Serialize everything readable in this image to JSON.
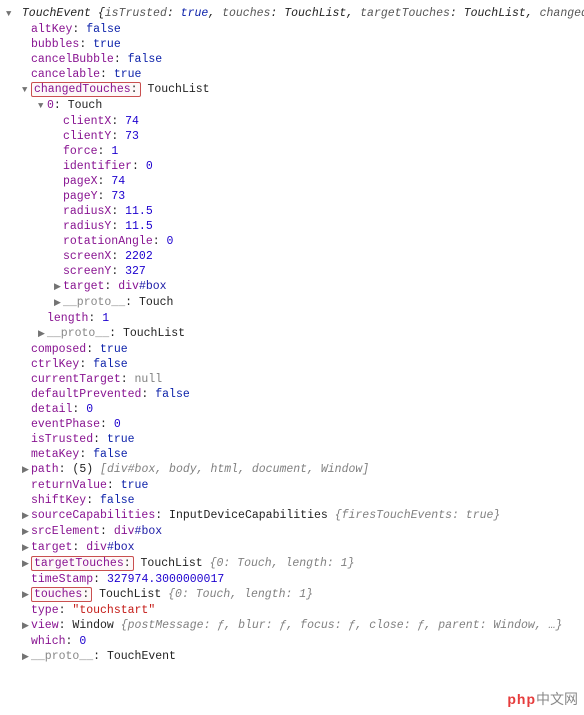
{
  "root": {
    "type": "TouchEvent",
    "preview_keys": [
      "isTrusted",
      "touches",
      "targetTouches",
      "changedTou"
    ],
    "preview": {
      "isTrusted": "true",
      "touches": "TouchList",
      "targetTouches": "TouchList",
      "changedTou": ""
    }
  },
  "props": {
    "altKey": "false",
    "bubbles": "true",
    "cancelBubble": "false",
    "cancelable": "true",
    "changedTouches": "TouchList",
    "composed": "true",
    "ctrlKey": "false",
    "currentTarget": "null",
    "defaultPrevented": "false",
    "detail": "0",
    "eventPhase": "0",
    "isTrusted": "true",
    "metaKey": "false",
    "path_len": "5",
    "path_preview": "[div#box, body, html, document, Window]",
    "returnValue": "true",
    "shiftKey": "false",
    "sourceCapabilities_type": "InputDeviceCapabilities",
    "sourceCapabilities_preview": "{firesTouchEvents: true}",
    "srcElement_tag": "div",
    "srcElement_id": "#box",
    "target_tag": "div",
    "target_id": "#box",
    "targetTouches_type": "TouchList",
    "targetTouches_preview": "{0: Touch, length: 1}",
    "timeStamp": "327974.3000000017",
    "touches_type": "TouchList",
    "touches_preview": "{0: Touch, length: 1}",
    "type": "\"touchstart\"",
    "view_type": "Window",
    "view_preview": "{postMessage: ƒ, blur: ƒ, focus: ƒ, close: ƒ, parent: Window, …}",
    "which": "0",
    "proto": "TouchEvent"
  },
  "changedTouches": {
    "index": "0",
    "type": "Touch",
    "clientX": "74",
    "clientY": "73",
    "force": "1",
    "identifier": "0",
    "pageX": "74",
    "pageY": "73",
    "radiusX": "11.5",
    "radiusY": "11.5",
    "rotationAngle": "0",
    "screenX": "2202",
    "screenY": "327",
    "target_tag": "div",
    "target_id": "#box",
    "proto": "Touch",
    "length": "1",
    "outer_proto": "TouchList"
  },
  "labels": {
    "altKey": "altKey",
    "bubbles": "bubbles",
    "cancelBubble": "cancelBubble",
    "cancelable": "cancelable",
    "changedTouches": "changedTouches",
    "clientX": "clientX",
    "clientY": "clientY",
    "force": "force",
    "identifier": "identifier",
    "pageX": "pageX",
    "pageY": "pageY",
    "radiusX": "radiusX",
    "radiusY": "radiusY",
    "rotationAngle": "rotationAngle",
    "screenX": "screenX",
    "screenY": "screenY",
    "target": "target",
    "proto": "__proto__",
    "length": "length",
    "composed": "composed",
    "ctrlKey": "ctrlKey",
    "currentTarget": "currentTarget",
    "defaultPrevented": "defaultPrevented",
    "detail": "detail",
    "eventPhase": "eventPhase",
    "isTrusted": "isTrusted",
    "metaKey": "metaKey",
    "path": "path",
    "returnValue": "returnValue",
    "shiftKey": "shiftKey",
    "sourceCapabilities": "sourceCapabilities",
    "srcElement": "srcElement",
    "targetTouches": "targetTouches",
    "timeStamp": "timeStamp",
    "touches": "touches",
    "type": "type",
    "view": "view",
    "which": "which"
  },
  "watermark": {
    "brand": "php",
    "cn": "中文网"
  }
}
